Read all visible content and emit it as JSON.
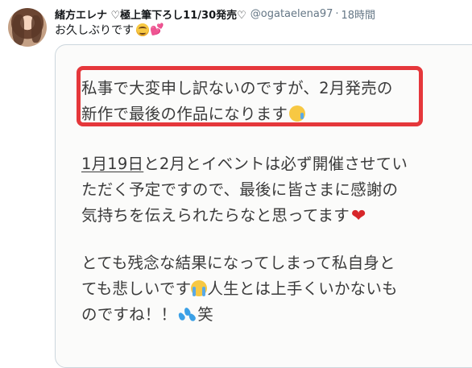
{
  "tweet": {
    "author_name": "緒方エレナ ♡極上筆下ろし11/30発売♡",
    "handle": "@ogataelena97",
    "separator": "·",
    "time": "18時間",
    "text": "お久しぶりです",
    "emoji_hearts": "💕"
  },
  "image": {
    "para1_line1": "私事で大変申し訳ないのですが、2月発売の",
    "para1_line2": "新作で最後の作品になります",
    "para2_line1_underlined": "1月19日",
    "para2_line1_rest": "と2月とイベントは必ず開催させてい",
    "para2_line2": "ただく予定ですので、最後に皆さまに感謝の",
    "para2_line3": "気持ちを伝えられたらなと思ってます",
    "heart": "❤",
    "para3_line1": "とても残念な結果になってしまって私自身と",
    "para3_line2_a": "ても悲しいです",
    "para3_line2_b": "人生とは上手くいかないも",
    "para3_line3_a": "のですね！！",
    "para3_line3_b": "笑"
  },
  "colors": {
    "highlight_border": "#e5373b",
    "muted_text": "#657786",
    "heart": "#d7262a"
  },
  "icons": [
    "avatar",
    "smiling-face-icon",
    "hearts-icon",
    "crying-face-icon",
    "sobbing-face-icon",
    "red-heart-icon",
    "sweat-droplets-icon"
  ]
}
